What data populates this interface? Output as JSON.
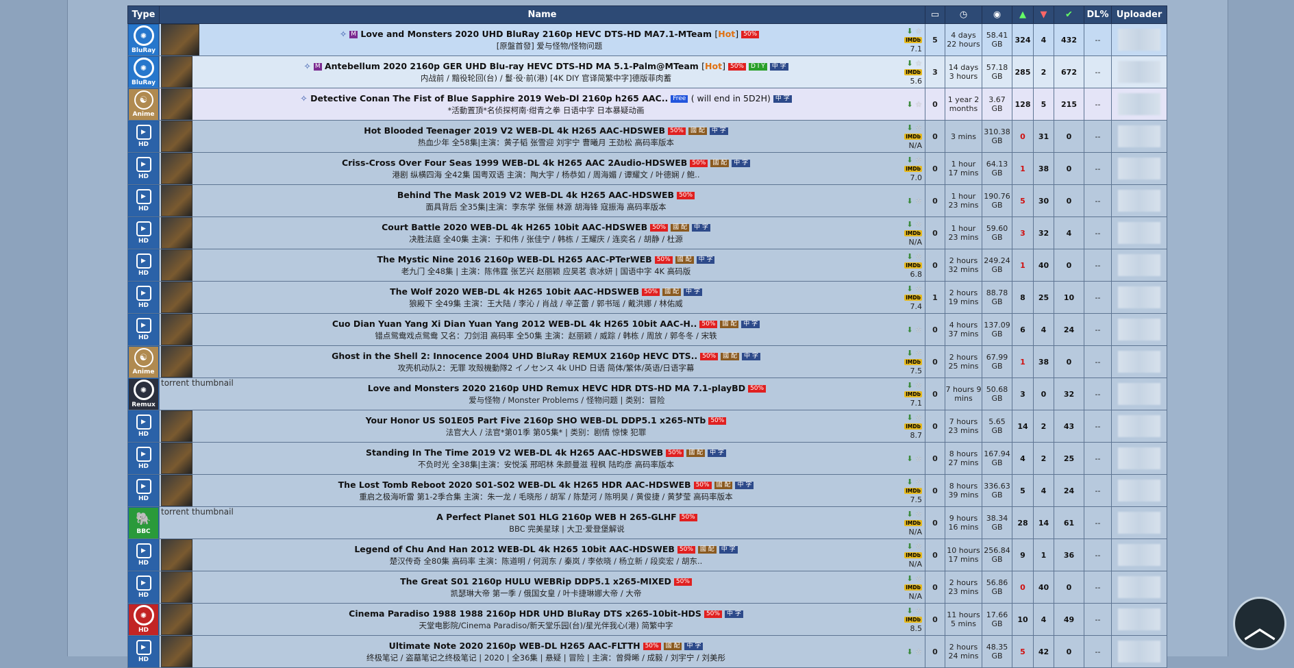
{
  "headers": {
    "type": "Type",
    "name": "Name",
    "comments_icon": "comment-icon",
    "time_icon": "clock-icon",
    "size_icon": "size-icon",
    "seeders_icon": "seeders-up-icon",
    "leechers_icon": "leechers-down-icon",
    "completed_icon": "completed-check-icon",
    "dl_pct": "DL%",
    "uploader": "Uploader"
  },
  "type_labels": {
    "hd": "HD",
    "bluray": "BluRay",
    "anime": "Anime",
    "remux": "Remux",
    "bbc": "BBC"
  },
  "tag_labels": {
    "fifty": "50%",
    "guopei": "國 配",
    "zh": "中 字",
    "free": "Free",
    "diy": "D I Y",
    "m": "M",
    "hot": "Hot"
  },
  "thumb_alt": "torrent thumbnail",
  "imdb_label": "IMDb",
  "rows": [
    {
      "type": "bluray",
      "title": "Love and Monsters 2020 UHD BluRay 2160p HEVC DTS-HD MA7.1-MTeam",
      "sub": "[原盤首發] 爱与怪物/怪物问题",
      "comments": "5",
      "time": "4 days 22 hours",
      "size": "58.41 GB",
      "seeders": "324",
      "leechers": "4",
      "completed": "432",
      "dl": "--",
      "imdb": "7.1"
    },
    {
      "type": "bluray",
      "title": "Antebellum 2020 2160p GER UHD Blu-ray HEVC DTS-HD MA 5.1-Palm@MTeam",
      "sub": "内战前 / 黯役轮回(台) / 鬘·役·前(港) [4K DIY 官译简繁中字]德版菲肉蓄",
      "comments": "3",
      "time": "14 days 3 hours",
      "size": "57.18 GB",
      "seeders": "285",
      "leechers": "2",
      "completed": "672",
      "dl": "--",
      "imdb": "5.6"
    },
    {
      "type": "anime",
      "title": "Detective Conan The Fist of Blue Sapphire 2019 Web-Dl 2160p h265 AAC..",
      "sub": "*活動置頂*名侦探柯南·绀青之拳 日语中字 日本暴疑动画",
      "free_note": "( will end in 5D2H)",
      "comments": "0",
      "time": "1 year 2 months",
      "size": "3.67 GB",
      "seeders": "128",
      "leechers": "5",
      "completed": "215",
      "dl": "--",
      "imdb": ""
    },
    {
      "type": "hd",
      "title": "Hot Blooded Teenager 2019 V2 WEB-DL 4k H265 AAC-HDSWEB",
      "sub": "热血少年 全58集|主演：黄子韬 张雪迎 刘宇宁 曹曦月 王劲松 高码率版本",
      "comments": "0",
      "time": "3 mins",
      "size": "310.38 GB",
      "seeders": "0",
      "leechers": "31",
      "completed": "0",
      "dl": "--",
      "imdb": "N/A"
    },
    {
      "type": "hd",
      "title": "Criss-Cross Over Four Seas 1999 WEB-DL 4k H265 AAC 2Audio-HDSWEB",
      "sub": "港剧 纵横四海 全42集 国粤双语 主演：陶大宇 / 杨恭如 / 周海媚 / 谭耀文 / 叶德娴 / 鲍..",
      "comments": "0",
      "time": "1 hour 17 mins",
      "size": "64.13 GB",
      "seeders": "1",
      "leechers": "38",
      "completed": "0",
      "dl": "--",
      "imdb": "7.0"
    },
    {
      "type": "hd",
      "title": "Behind The Mask 2019 V2 WEB-DL 4k H265 AAC-HDSWEB",
      "sub": "面具背后 全35集|主演：李东学 张俪 林源 胡海锋 寇振海 高码率版本",
      "comments": "0",
      "time": "1 hour 23 mins",
      "size": "190.76 GB",
      "seeders": "5",
      "leechers": "30",
      "completed": "0",
      "dl": "--",
      "imdb": ""
    },
    {
      "type": "hd",
      "title": "Court Battle 2020 WEB-DL 4k H265 10bit AAC-HDSWEB",
      "sub": "决胜法庭 全40集 主演：于和伟 / 张佳宁 / 韩栋 / 王耀庆 / 连奕名 / 胡静 / 杜源",
      "comments": "0",
      "time": "1 hour 23 mins",
      "size": "59.60 GB",
      "seeders": "3",
      "leechers": "32",
      "completed": "4",
      "dl": "--",
      "imdb": "N/A"
    },
    {
      "type": "hd",
      "title": "The Mystic Nine 2016 2160p WEB-DL H265 AAC-PTerWEB",
      "sub": "老九门 全48集 | 主演：陈伟霆 张艺兴 赵丽颖 应昊茗 袁冰妍 | 国语中字 4K 高码版",
      "comments": "0",
      "time": "2 hours 32 mins",
      "size": "249.24 GB",
      "seeders": "1",
      "leechers": "40",
      "completed": "0",
      "dl": "--",
      "imdb": "6.8"
    },
    {
      "type": "hd",
      "title": "The Wolf 2020 WEB-DL 4k H265 10bit AAC-HDSWEB",
      "sub": "狼殿下 全49集 主演：王大陆 / 李沁 / 肖战 / 辛芷蕾 / 郭书瑶 / 戴洪娜 / 林佑威",
      "comments": "1",
      "time": "2 hours 19 mins",
      "size": "88.78 GB",
      "seeders": "8",
      "leechers": "25",
      "completed": "10",
      "dl": "--",
      "imdb": "7.4"
    },
    {
      "type": "hd",
      "title": "Cuo Dian Yuan Yang Xi Dian Yuan Yang 2012 WEB-DL 4k H265 10bit AAC-H..",
      "sub": "错点鸳鸯戏点鸳鸯 又名：刀剑泪 高码率 全50集 主演：赵丽颖 / 威踪 / 韩栋 / 周放 / 郭冬冬 / 宋轶",
      "comments": "0",
      "time": "4 hours 37 mins",
      "size": "137.09 GB",
      "seeders": "6",
      "leechers": "4",
      "completed": "24",
      "dl": "--",
      "imdb": ""
    },
    {
      "type": "anime",
      "title": "Ghost in the Shell 2: Innocence 2004 UHD BluRay REMUX 2160p HEVC DTS..",
      "sub": "攻壳机动队2：无罪 攻殻機動隊2 イノセンス 4k UHD 日语 简体/繁体/英语/日语字幕",
      "comments": "0",
      "time": "2 hours 25 mins",
      "size": "67.99 GB",
      "seeders": "1",
      "leechers": "38",
      "completed": "0",
      "dl": "--",
      "imdb": "7.5"
    },
    {
      "type": "remux",
      "title": "Love and Monsters 2020 2160p UHD Remux HEVC HDR DTS-HD MA 7.1-playBD",
      "sub": "爱与怪物 / Monster Problems / 怪物问题 | 类别：冒险",
      "comments": "0",
      "time": "7 hours 9 mins",
      "size": "50.68 GB",
      "seeders": "3",
      "leechers": "0",
      "completed": "32",
      "dl": "--",
      "imdb": "7.1"
    },
    {
      "type": "hd",
      "title": "Your Honor US S01E05 Part Five 2160p SHO WEB-DL DDP5.1 x265-NTb",
      "sub": "法官大人 / 法官*第01季 第05集* | 类别：剧情 惊悚 犯罪",
      "comments": "0",
      "time": "7 hours 23 mins",
      "size": "5.65 GB",
      "seeders": "14",
      "leechers": "2",
      "completed": "43",
      "dl": "--",
      "imdb": "8.7"
    },
    {
      "type": "hd",
      "title": "Standing In The Time 2019 V2 WEB-DL 4k H265 AAC-HDSWEB",
      "sub": "不负时光 全38集|主演：安悦溪 邢昭林 朱颜曼滋 程枫 陆昀彦 高码率版本",
      "comments": "0",
      "time": "8 hours 27 mins",
      "size": "167.94 GB",
      "seeders": "4",
      "leechers": "2",
      "completed": "25",
      "dl": "--",
      "imdb": ""
    },
    {
      "type": "hd",
      "title": "The Lost Tomb Reboot 2020 S01-S02 WEB-DL 4k H265 HDR AAC-HDSWEB",
      "sub": "重启之极海听雷 第1-2季合集 主演：朱一龙 / 毛晓彤 / 胡军 / 陈楚河 / 陈明昊 / 黄俊捷 / 黄梦莹 高码率版本",
      "comments": "0",
      "time": "8 hours 39 mins",
      "size": "336.63 GB",
      "seeders": "5",
      "leechers": "4",
      "completed": "24",
      "dl": "--",
      "imdb": "7.5"
    },
    {
      "type": "bbc",
      "title": "A Perfect Planet S01 HLG 2160p WEB H 265-GLHF",
      "sub": "BBC 完美星球 | 大卫·爱登堡解说",
      "comments": "0",
      "time": "9 hours 16 mins",
      "size": "38.34 GB",
      "seeders": "28",
      "leechers": "14",
      "completed": "61",
      "dl": "--",
      "imdb": "N/A"
    },
    {
      "type": "hd",
      "title": "Legend of Chu And Han 2012 WEB-DL 4k H265 10bit AAC-HDSWEB",
      "sub": "楚汉传奇 全80集 高码率 主演：陈道明 / 何润东 / 秦岚 / 李依晓 / 杨立新 / 段奕宏 / 胡东..",
      "comments": "0",
      "time": "10 hours 17 mins",
      "size": "256.84 GB",
      "seeders": "9",
      "leechers": "1",
      "completed": "36",
      "dl": "--",
      "imdb": "N/A"
    },
    {
      "type": "hd",
      "title": "The Great S01 2160p HULU WEBRip DDP5.1 x265-MIXED",
      "sub": "凯瑟琳大帝 第一季 / 俄国女皇 / 叶卡捷琳娜大帝 / 大帝",
      "comments": "0",
      "time": "2 hours 23 mins",
      "size": "56.86 GB",
      "seeders": "0",
      "leechers": "40",
      "completed": "0",
      "dl": "--",
      "imdb": "N/A"
    },
    {
      "type": "hdred",
      "title": "Cinema Paradiso 1988 1988 2160p HDR UHD BluRay DTS x265-10bit-HDS",
      "sub": "天堂电影院/Cinema Paradiso/新天堂乐园(台)/星光伴我心(港) 简繁中字",
      "comments": "0",
      "time": "11 hours 5 mins",
      "size": "17.66 GB",
      "seeders": "10",
      "leechers": "4",
      "completed": "49",
      "dl": "--",
      "imdb": "8.5"
    },
    {
      "type": "hd",
      "title": "Ultimate Note 2020 2160p WEB-DL H265 AAC-FLTTH",
      "sub": "终极笔记 / 盗墓笔记之终极笔记 | 2020 | 全36集 | 悬疑 | 冒险 | 主演：曾舜晞 / 成毅 / 刘宇宁 / 刘美彤",
      "comments": "0",
      "time": "2 hours 24 mins",
      "size": "48.35 GB",
      "seeders": "5",
      "leechers": "42",
      "completed": "0",
      "dl": "--",
      "imdb": ""
    }
  ],
  "scroll_top_icon": "chevron-up-icon"
}
